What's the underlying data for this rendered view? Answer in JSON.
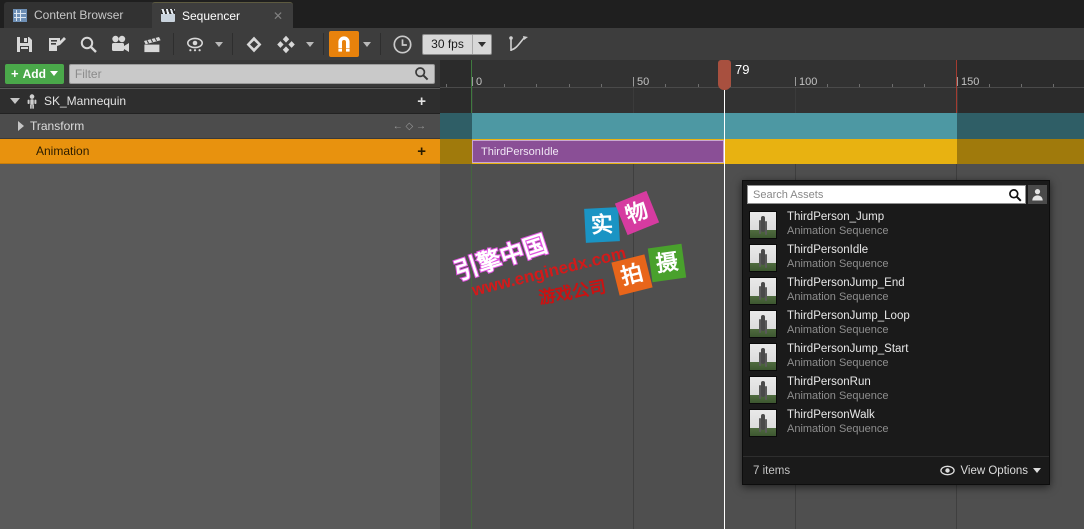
{
  "tabs": [
    {
      "label": "Content Browser",
      "icon": "grid-icon",
      "active": false
    },
    {
      "label": "Sequencer",
      "icon": "clapperboard-icon",
      "active": true
    }
  ],
  "toolbar": {
    "save_label": "save-icon",
    "edit_label": "create-camera-icon",
    "find_label": "find-icon",
    "camera_label": "camera-icon",
    "clapper_label": "render-movie-icon",
    "visibility_label": "visibility-options",
    "key_label": "add-key-icon",
    "keys_label": "key-interpolation",
    "snap_label": "snapping-toggle",
    "clock_label": "time-options",
    "fps_value": "30 fps",
    "curve_label": "curve-editor-icon"
  },
  "outliner": {
    "add_button": "Add",
    "add_plus": "+",
    "filter_placeholder": "Filter",
    "rows": [
      {
        "label": "SK_Mannequin",
        "type": "object",
        "plus": "+"
      },
      {
        "label": "Transform",
        "type": "track",
        "nav": "← ◇ →"
      },
      {
        "label": "Animation",
        "type": "track-selected",
        "plus": "+"
      }
    ]
  },
  "timeline": {
    "tick_labels": [
      "0",
      "50",
      "100",
      "150"
    ],
    "tick_values": [
      0,
      50,
      100,
      150
    ],
    "playhead_frame": "79",
    "playback_start": 0,
    "playback_end": 150,
    "clip_label": "ThirdPersonIdle"
  },
  "picker": {
    "search_placeholder": "Search Assets",
    "search_icon": "magnifier-icon",
    "avatar_icon": "user-icon",
    "assets": [
      {
        "name": "ThirdPerson_Jump",
        "type": "Animation Sequence"
      },
      {
        "name": "ThirdPersonIdle",
        "type": "Animation Sequence"
      },
      {
        "name": "ThirdPersonJump_End",
        "type": "Animation Sequence"
      },
      {
        "name": "ThirdPersonJump_Loop",
        "type": "Animation Sequence"
      },
      {
        "name": "ThirdPersonJump_Start",
        "type": "Animation Sequence"
      },
      {
        "name": "ThirdPersonRun",
        "type": "Animation Sequence"
      },
      {
        "name": "ThirdPersonWalk",
        "type": "Animation Sequence"
      }
    ],
    "item_count": "7 items",
    "view_options": "View Options",
    "view_options_icon": "eye-icon"
  },
  "watermark": {
    "brand": "引擎中国",
    "url": "www.enginedx.com",
    "tagline": "游戏公司",
    "chip1": "实",
    "chip2": "物",
    "chip3": "拍",
    "chip4": "摄"
  },
  "colors": {
    "accent_orange": "#e8920e",
    "snap_orange": "#e8820c",
    "add_green": "#4aa84a",
    "transform_teal": "#4d98a3",
    "anim_yellow": "#e8b211",
    "clip_purple": "#8a4f96",
    "playhead_red": "#a8503f"
  }
}
